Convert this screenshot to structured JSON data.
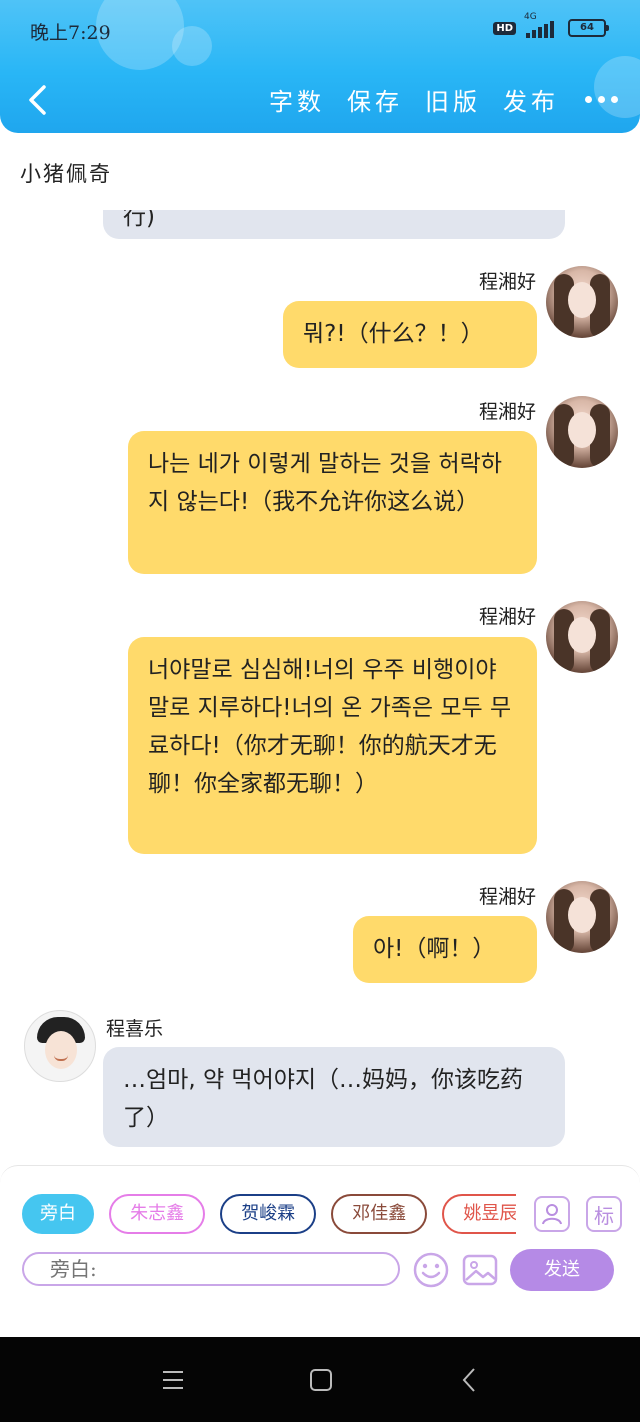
{
  "status_bar": {
    "time": "晚上7:29",
    "network": "4G",
    "hd_label": "HD",
    "battery": "64"
  },
  "header": {
    "actions": [
      {
        "label": "字数"
      },
      {
        "label": "保存"
      },
      {
        "label": "旧版"
      },
      {
        "label": "发布"
      }
    ]
  },
  "conversation": {
    "title": "小猪佩奇"
  },
  "messages": [
    {
      "side": "left",
      "sender": "",
      "text": "行)"
    },
    {
      "side": "right",
      "sender": "程湘好",
      "text": "뭐?!（什么？！）"
    },
    {
      "side": "right",
      "sender": "程湘好",
      "text": "나는 네가 이렇게 말하는 것을 허락하지 않는다!（我不允许你这么说）"
    },
    {
      "side": "right",
      "sender": "程湘好",
      "text": "너야말로 심심해!너의 우주 비행이야말로 지루하다!너의 온 가족은 모두 무료하다!（你才无聊！你的航天才无聊！你全家都无聊！）"
    },
    {
      "side": "right",
      "sender": "程湘好",
      "text": "아!（啊！）"
    },
    {
      "side": "left",
      "sender": "程喜乐",
      "text": "…엄마, 약 먹어야지（…妈妈，你该吃药了）"
    }
  ],
  "input_area": {
    "roles": [
      {
        "label": "旁白",
        "color": "#45c6f0"
      },
      {
        "label": "朱志鑫",
        "color": "#e57de8"
      },
      {
        "label": "贺峻霖",
        "color": "#1b3f87"
      },
      {
        "label": "邓佳鑫",
        "color": "#8a4a3a"
      },
      {
        "label": "姚昱辰",
        "color": "#e0554a"
      }
    ],
    "tool_label_tag": "标",
    "input_placeholder": "旁白:",
    "send_label": "发送"
  }
}
